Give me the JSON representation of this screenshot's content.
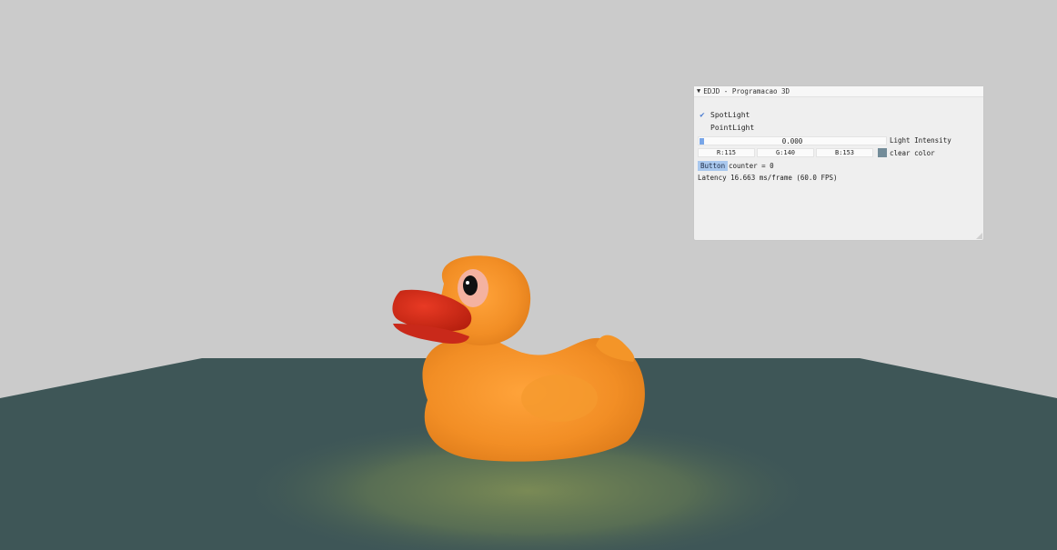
{
  "window": {
    "title": "EDJD - Programacao 3D"
  },
  "controls": {
    "spotlight": {
      "label": "SpotLight",
      "checked": true
    },
    "pointlight": {
      "label": "PointLight",
      "checked": false
    },
    "light_intensity": {
      "value": "0.000",
      "label": "Light Intensity",
      "fraction": 0.0
    },
    "clear_color": {
      "r": "R:115",
      "g": "G:140",
      "b": "B:153",
      "label": "clear color",
      "swatch": "#738c99"
    },
    "button": {
      "label": "Button",
      "counter_text": "counter = 0"
    },
    "latency_text": "Latency 16.663 ms/frame (60.0 FPS)"
  },
  "scene": {
    "background": "#cbcbcb",
    "floor_color": "#3e5657",
    "duck_color": "#f1922a",
    "beak_color": "#d9301c"
  }
}
